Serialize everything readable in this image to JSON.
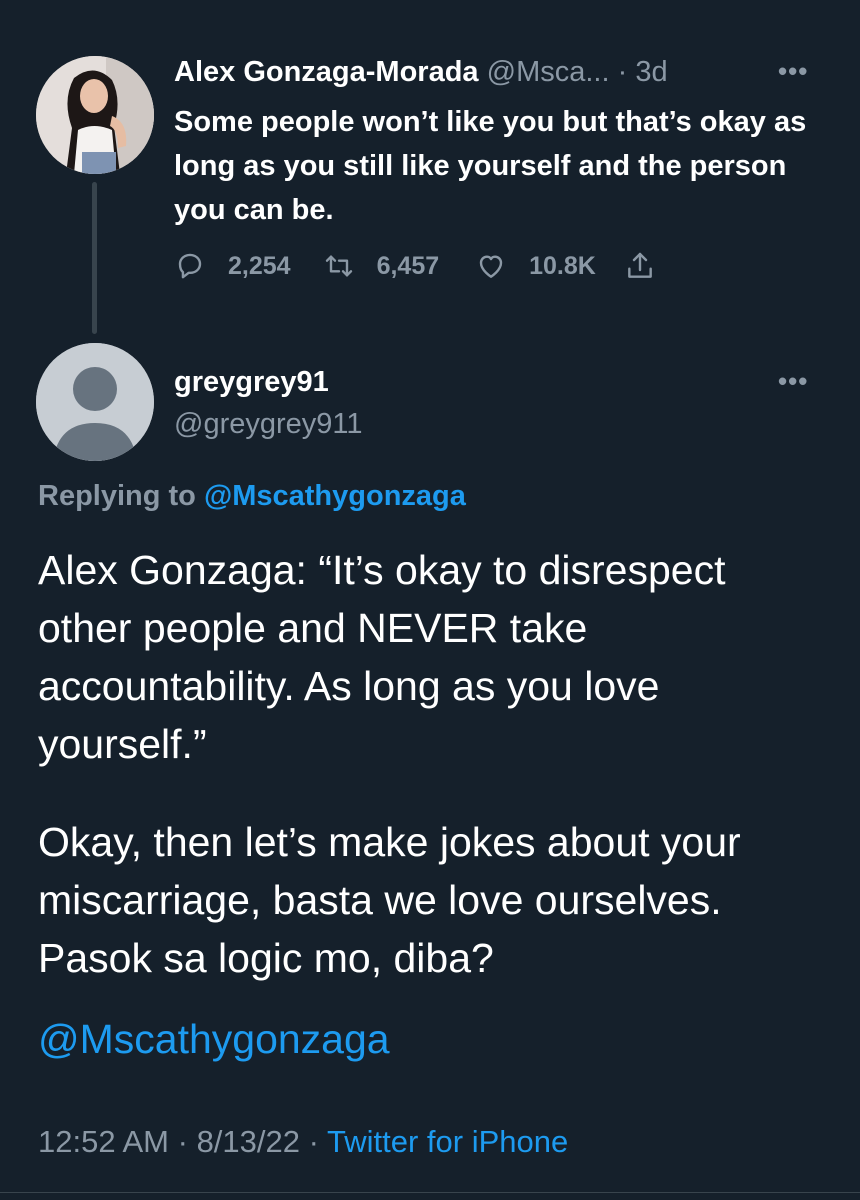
{
  "parent_tweet": {
    "author_name": "Alex Gonzaga-Morada",
    "handle": "@Msca...",
    "separator": "·",
    "time": "3d",
    "more": "•••",
    "text": "Some people won’t like you but that’s okay as long as you still like yourself and the person you can be.",
    "replies": "2,254",
    "retweets": "6,457",
    "likes": "10.8K"
  },
  "reply_tweet": {
    "author_name": "greygrey91",
    "handle": "@greygrey911",
    "more": "•••",
    "replying_to_label": "Replying to",
    "replying_to_mention": "@Mscathygonzaga",
    "paragraph_1": "Alex Gonzaga: “It’s okay to disrespect other people and NEVER take accountability. As long as you love yourself.”",
    "paragraph_2": "Okay, then let’s make jokes about your miscarriage, basta we love ourselves. Pasok sa logic mo, diba?",
    "mention": "@Mscathygonzaga",
    "time": "12:52 AM",
    "separator": "·",
    "date": "8/13/22",
    "source": "Twitter for iPhone"
  },
  "colors": {
    "background": "#15202b",
    "primary_text": "#ffffff",
    "secondary_text": "#8b98a5",
    "accent": "#1d9bf0"
  },
  "icons": {
    "reply": "reply-icon",
    "retweet": "retweet-icon",
    "like": "heart-icon",
    "share": "share-icon"
  }
}
